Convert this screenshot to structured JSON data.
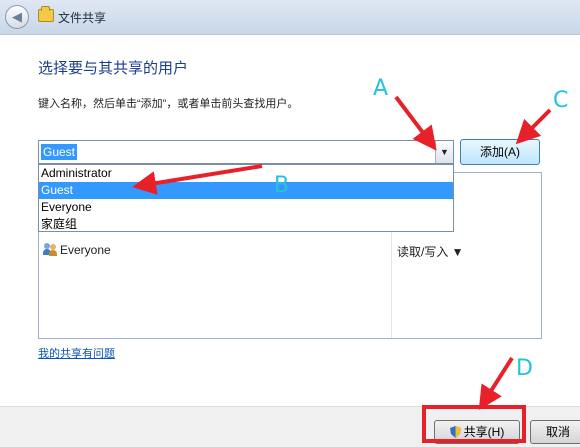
{
  "window": {
    "title": "文件共享"
  },
  "section_title": "选择要与其共享的用户",
  "instructions": "键入名称，然后单击“添加”，或者单击前头查找用户。",
  "name_input": {
    "value": "Guest"
  },
  "add_button": {
    "label": "添加(A)"
  },
  "dropdown": {
    "options": [
      {
        "label": "Administrator"
      },
      {
        "label": "Guest"
      },
      {
        "label": "Everyone"
      },
      {
        "label": "家庭组"
      }
    ],
    "selected": "Guest"
  },
  "share_table": {
    "rows": [
      {
        "name": "Everyone",
        "permission": "读取/写入 ▼"
      }
    ]
  },
  "help_link": "我的共享有问题",
  "footer": {
    "share_label": "共享(H)",
    "cancel_label": "取消"
  },
  "annotations": {
    "color_red": "#e8202a",
    "color_cyan": "#25c3d9",
    "labels": [
      "A",
      "B",
      "C",
      "D"
    ]
  }
}
